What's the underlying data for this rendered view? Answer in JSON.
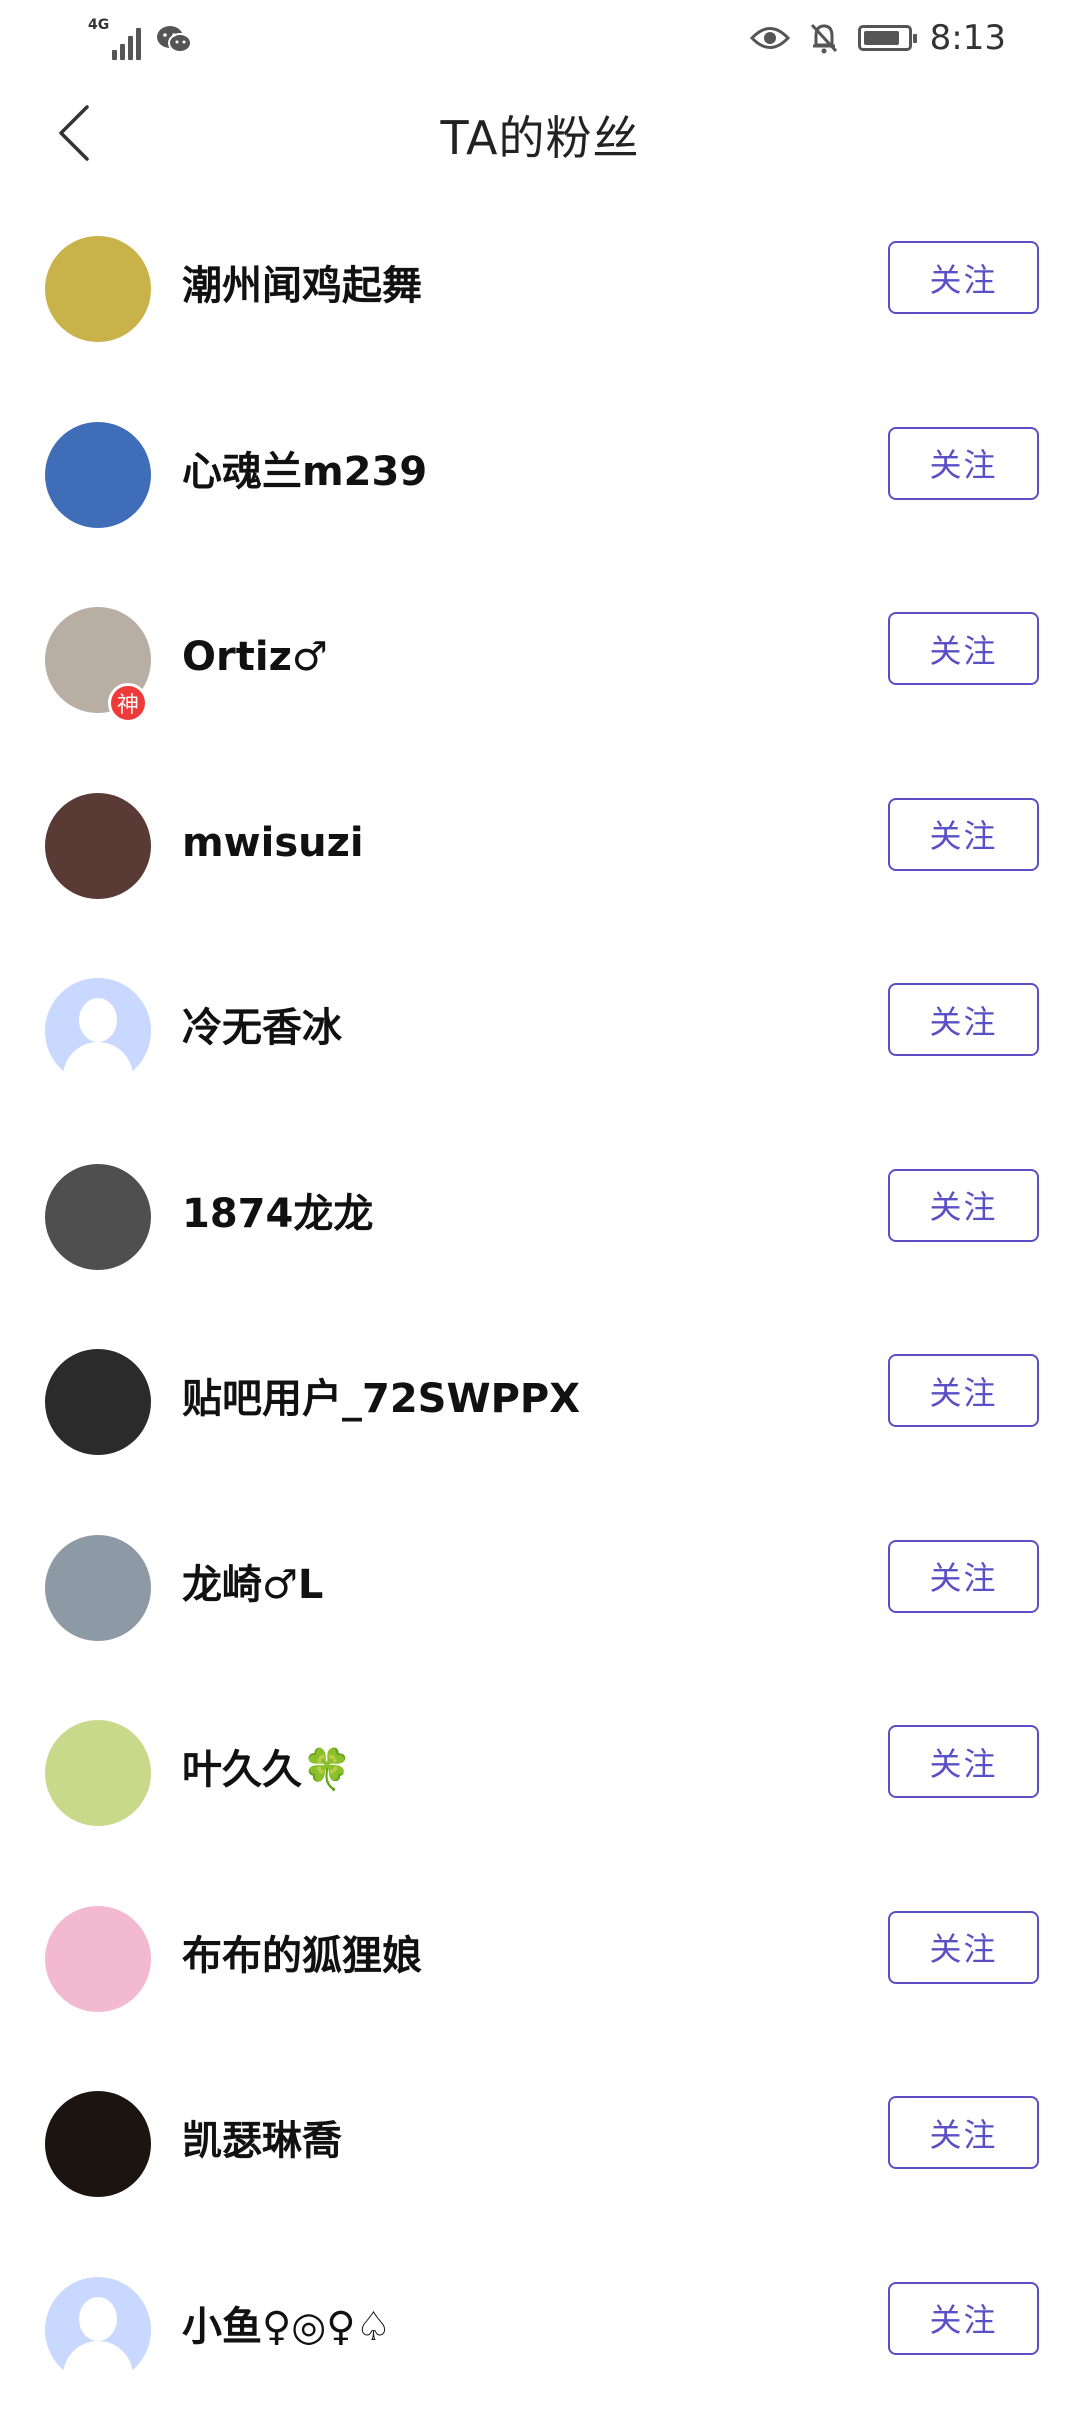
{
  "status_bar": {
    "network": "4G",
    "time": "8:13",
    "battery_level": 0.85,
    "icons": [
      "signal-icon",
      "wechat-icon",
      "eye-icon",
      "bell-off-icon",
      "battery-icon"
    ]
  },
  "header": {
    "title": "TA的粉丝",
    "back_icon": "chevron-left-icon"
  },
  "accent_color": "#5b4fc5",
  "fans": [
    {
      "name": "潮州闻鸡起舞",
      "follow_label": "关注",
      "avatar_color": "#c9b24a",
      "badge": null
    },
    {
      "name": "心魂兰m239",
      "follow_label": "关注",
      "avatar_color": "#3f6db8",
      "badge": null
    },
    {
      "name": "Ortiz♂",
      "follow_label": "关注",
      "avatar_color": "#b9aea3",
      "badge": "神"
    },
    {
      "name": "mwisuzi",
      "follow_label": "关注",
      "avatar_color": "#5a3a35",
      "badge": null
    },
    {
      "name": "冷无香冰",
      "follow_label": "关注",
      "avatar_color": "#c8d8ff",
      "badge": null,
      "placeholder": true
    },
    {
      "name": "1874龙龙",
      "follow_label": "关注",
      "avatar_color": "#4f4f4f",
      "badge": null
    },
    {
      "name": "贴吧用户_72SWPPX",
      "follow_label": "关注",
      "avatar_color": "#2b2b2b",
      "badge": null
    },
    {
      "name": "龙崎♂L",
      "follow_label": "关注",
      "avatar_color": "#8d9aa6",
      "badge": null
    },
    {
      "name": "叶久久🍀",
      "follow_label": "关注",
      "avatar_color": "#c9d98a",
      "badge": null
    },
    {
      "name": "布布的狐狸娘",
      "follow_label": "关注",
      "avatar_color": "#f3b9cf",
      "badge": null
    },
    {
      "name": "凯瑟琳喬",
      "follow_label": "关注",
      "avatar_color": "#1b1410",
      "badge": null
    },
    {
      "name": "小鱼♀◎♀♤",
      "follow_label": "关注",
      "avatar_color": "#c8d8ff",
      "badge": null,
      "placeholder": true
    }
  ]
}
